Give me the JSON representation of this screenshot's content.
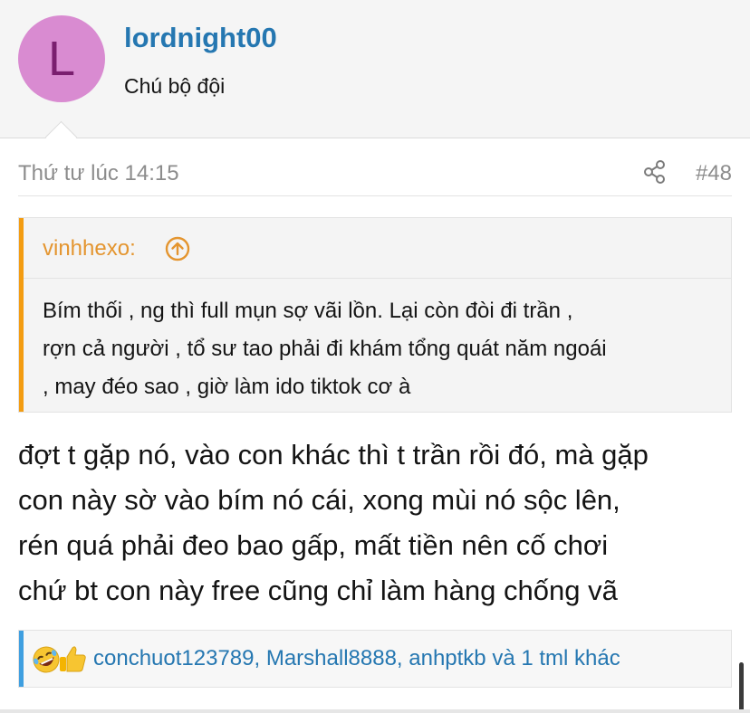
{
  "user": {
    "avatar_letter": "L",
    "name": "lordnight00",
    "title": "Chú bộ đội",
    "avatar_color": "#d98bd1"
  },
  "post": {
    "date": "Thứ tư lúc 14:15",
    "number": "#48",
    "share_icon": "share-icon",
    "body_lines": [
      "đợt t gặp nó, vào con khác thì t trần rồi đó, mà gặp",
      "con này sờ vào bím nó cái, xong mùi nó sộc lên,",
      "rén quá phải đeo bao gấp, mất tiền nên cố chơi",
      "chứ bt con này free cũng chỉ làm hàng chống vã"
    ]
  },
  "quote": {
    "author": "vinhhexo:",
    "jump_icon": "arrow-up-circle-icon",
    "lines": [
      "Bím thối , ng thì full mụn sợ vãi lồn. Lại còn đòi đi trần ,",
      "rợn cả người , tổ sư tao phải đi khám tổng quát năm ngoái",
      ", may đéo sao , giờ làm ido tiktok cơ à"
    ],
    "accent_color": "#f39c12"
  },
  "reactions": {
    "icons": [
      "rofl-emoji-icon",
      "thumbs-up-emoji-icon"
    ],
    "text": "conchuot123789, Marshall8888, anhptkb và 1 tml khác",
    "accent_color": "#3f9fe0"
  },
  "colors": {
    "link": "#2577b1",
    "meta": "#8c8c8c"
  }
}
